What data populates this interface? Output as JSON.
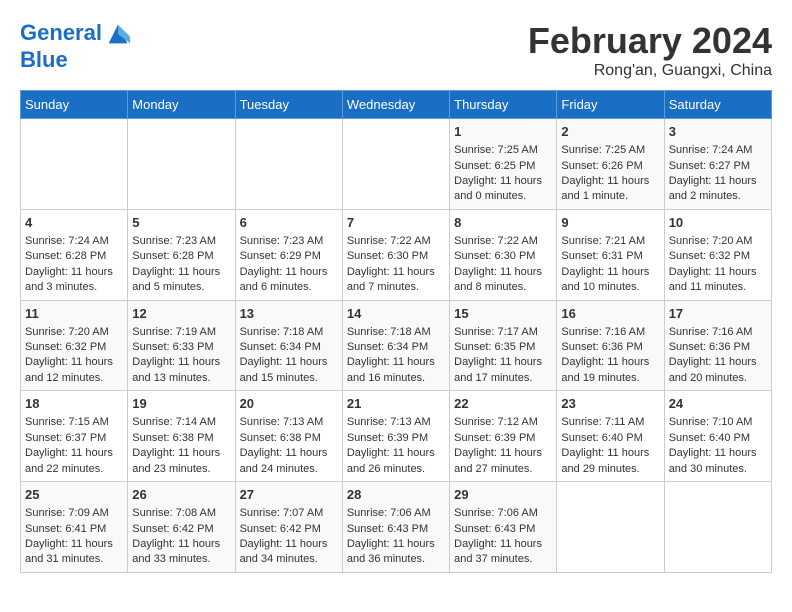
{
  "header": {
    "logo_line1": "General",
    "logo_line2": "Blue",
    "month_title": "February 2024",
    "location": "Rong'an, Guangxi, China"
  },
  "days_of_week": [
    "Sunday",
    "Monday",
    "Tuesday",
    "Wednesday",
    "Thursday",
    "Friday",
    "Saturday"
  ],
  "weeks": [
    [
      {
        "day": "",
        "content": ""
      },
      {
        "day": "",
        "content": ""
      },
      {
        "day": "",
        "content": ""
      },
      {
        "day": "",
        "content": ""
      },
      {
        "day": "1",
        "content": "Sunrise: 7:25 AM\nSunset: 6:25 PM\nDaylight: 11 hours and 0 minutes."
      },
      {
        "day": "2",
        "content": "Sunrise: 7:25 AM\nSunset: 6:26 PM\nDaylight: 11 hours and 1 minute."
      },
      {
        "day": "3",
        "content": "Sunrise: 7:24 AM\nSunset: 6:27 PM\nDaylight: 11 hours and 2 minutes."
      }
    ],
    [
      {
        "day": "4",
        "content": "Sunrise: 7:24 AM\nSunset: 6:28 PM\nDaylight: 11 hours and 3 minutes."
      },
      {
        "day": "5",
        "content": "Sunrise: 7:23 AM\nSunset: 6:28 PM\nDaylight: 11 hours and 5 minutes."
      },
      {
        "day": "6",
        "content": "Sunrise: 7:23 AM\nSunset: 6:29 PM\nDaylight: 11 hours and 6 minutes."
      },
      {
        "day": "7",
        "content": "Sunrise: 7:22 AM\nSunset: 6:30 PM\nDaylight: 11 hours and 7 minutes."
      },
      {
        "day": "8",
        "content": "Sunrise: 7:22 AM\nSunset: 6:30 PM\nDaylight: 11 hours and 8 minutes."
      },
      {
        "day": "9",
        "content": "Sunrise: 7:21 AM\nSunset: 6:31 PM\nDaylight: 11 hours and 10 minutes."
      },
      {
        "day": "10",
        "content": "Sunrise: 7:20 AM\nSunset: 6:32 PM\nDaylight: 11 hours and 11 minutes."
      }
    ],
    [
      {
        "day": "11",
        "content": "Sunrise: 7:20 AM\nSunset: 6:32 PM\nDaylight: 11 hours and 12 minutes."
      },
      {
        "day": "12",
        "content": "Sunrise: 7:19 AM\nSunset: 6:33 PM\nDaylight: 11 hours and 13 minutes."
      },
      {
        "day": "13",
        "content": "Sunrise: 7:18 AM\nSunset: 6:34 PM\nDaylight: 11 hours and 15 minutes."
      },
      {
        "day": "14",
        "content": "Sunrise: 7:18 AM\nSunset: 6:34 PM\nDaylight: 11 hours and 16 minutes."
      },
      {
        "day": "15",
        "content": "Sunrise: 7:17 AM\nSunset: 6:35 PM\nDaylight: 11 hours and 17 minutes."
      },
      {
        "day": "16",
        "content": "Sunrise: 7:16 AM\nSunset: 6:36 PM\nDaylight: 11 hours and 19 minutes."
      },
      {
        "day": "17",
        "content": "Sunrise: 7:16 AM\nSunset: 6:36 PM\nDaylight: 11 hours and 20 minutes."
      }
    ],
    [
      {
        "day": "18",
        "content": "Sunrise: 7:15 AM\nSunset: 6:37 PM\nDaylight: 11 hours and 22 minutes."
      },
      {
        "day": "19",
        "content": "Sunrise: 7:14 AM\nSunset: 6:38 PM\nDaylight: 11 hours and 23 minutes."
      },
      {
        "day": "20",
        "content": "Sunrise: 7:13 AM\nSunset: 6:38 PM\nDaylight: 11 hours and 24 minutes."
      },
      {
        "day": "21",
        "content": "Sunrise: 7:13 AM\nSunset: 6:39 PM\nDaylight: 11 hours and 26 minutes."
      },
      {
        "day": "22",
        "content": "Sunrise: 7:12 AM\nSunset: 6:39 PM\nDaylight: 11 hours and 27 minutes."
      },
      {
        "day": "23",
        "content": "Sunrise: 7:11 AM\nSunset: 6:40 PM\nDaylight: 11 hours and 29 minutes."
      },
      {
        "day": "24",
        "content": "Sunrise: 7:10 AM\nSunset: 6:40 PM\nDaylight: 11 hours and 30 minutes."
      }
    ],
    [
      {
        "day": "25",
        "content": "Sunrise: 7:09 AM\nSunset: 6:41 PM\nDaylight: 11 hours and 31 minutes."
      },
      {
        "day": "26",
        "content": "Sunrise: 7:08 AM\nSunset: 6:42 PM\nDaylight: 11 hours and 33 minutes."
      },
      {
        "day": "27",
        "content": "Sunrise: 7:07 AM\nSunset: 6:42 PM\nDaylight: 11 hours and 34 minutes."
      },
      {
        "day": "28",
        "content": "Sunrise: 7:06 AM\nSunset: 6:43 PM\nDaylight: 11 hours and 36 minutes."
      },
      {
        "day": "29",
        "content": "Sunrise: 7:06 AM\nSunset: 6:43 PM\nDaylight: 11 hours and 37 minutes."
      },
      {
        "day": "",
        "content": ""
      },
      {
        "day": "",
        "content": ""
      }
    ]
  ]
}
